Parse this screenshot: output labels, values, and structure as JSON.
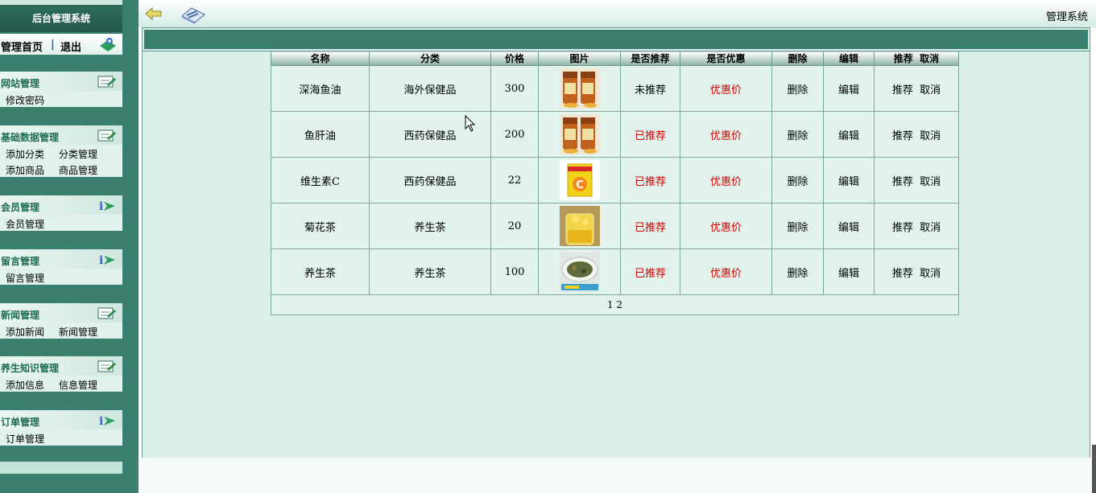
{
  "sidebar": {
    "title": "后台管理系统",
    "quick": {
      "home": "管理首页",
      "sep": "|",
      "logout": "退出"
    },
    "menus": [
      {
        "title": "网站管理",
        "items": [
          "修改密码"
        ]
      },
      {
        "title": "基础数据管理",
        "items": [
          "添加分类",
          "分类管理",
          "添加商品",
          "商品管理"
        ]
      },
      {
        "title": "会员管理",
        "items": [
          "会员管理"
        ]
      },
      {
        "title": "留言管理",
        "items": [
          "留言管理"
        ]
      },
      {
        "title": "新闻管理",
        "items": [
          "添加新闻",
          "新闻管理"
        ]
      },
      {
        "title": "养生知识管理",
        "items": [
          "添加信息",
          "信息管理"
        ]
      },
      {
        "title": "订单管理",
        "items": [
          "订单管理"
        ]
      }
    ]
  },
  "topbar": {
    "system_name": "管理系统"
  },
  "table": {
    "headers": [
      "名称",
      "分类",
      "价格",
      "图片",
      "是否推荐",
      "是否优惠",
      "删除",
      "编辑",
      "推荐",
      "取消"
    ],
    "rows": [
      {
        "name": "深海鱼油",
        "category": "海外保健品",
        "price": "300",
        "image": "fish-oil-bottles",
        "recommended": "未推荐",
        "discount": "优惠价",
        "delete": "删除",
        "edit": "编辑",
        "recommend": "推荐",
        "cancel": "取消"
      },
      {
        "name": "鱼肝油",
        "category": "西药保健品",
        "price": "200",
        "image": "fish-oil-bottles",
        "recommended": "已推荐",
        "discount": "优惠价",
        "delete": "删除",
        "edit": "编辑",
        "recommend": "推荐",
        "cancel": "取消"
      },
      {
        "name": "维生素C",
        "category": "西药保健品",
        "price": "22",
        "image": "vitamin-c-box",
        "recommended": "已推荐",
        "discount": "优惠价",
        "delete": "删除",
        "edit": "编辑",
        "recommend": "推荐",
        "cancel": "取消"
      },
      {
        "name": "菊花茶",
        "category": "养生茶",
        "price": "20",
        "image": "chrysanthemum-tea",
        "recommended": "已推荐",
        "discount": "优惠价",
        "delete": "删除",
        "edit": "编辑",
        "recommend": "推荐",
        "cancel": "取消"
      },
      {
        "name": "养生茶",
        "category": "养生茶",
        "price": "100",
        "image": "herbal-tea-plate",
        "recommended": "已推荐",
        "discount": "优惠价",
        "delete": "删除",
        "edit": "编辑",
        "recommend": "推荐",
        "cancel": "取消"
      }
    ],
    "pager": "1 2"
  },
  "colors": {
    "sidebar_bg": "#3b7f6e",
    "accent_red": "#d40000",
    "header_bar": "#3a7f6e",
    "panel_bg": "#d9efe7"
  }
}
